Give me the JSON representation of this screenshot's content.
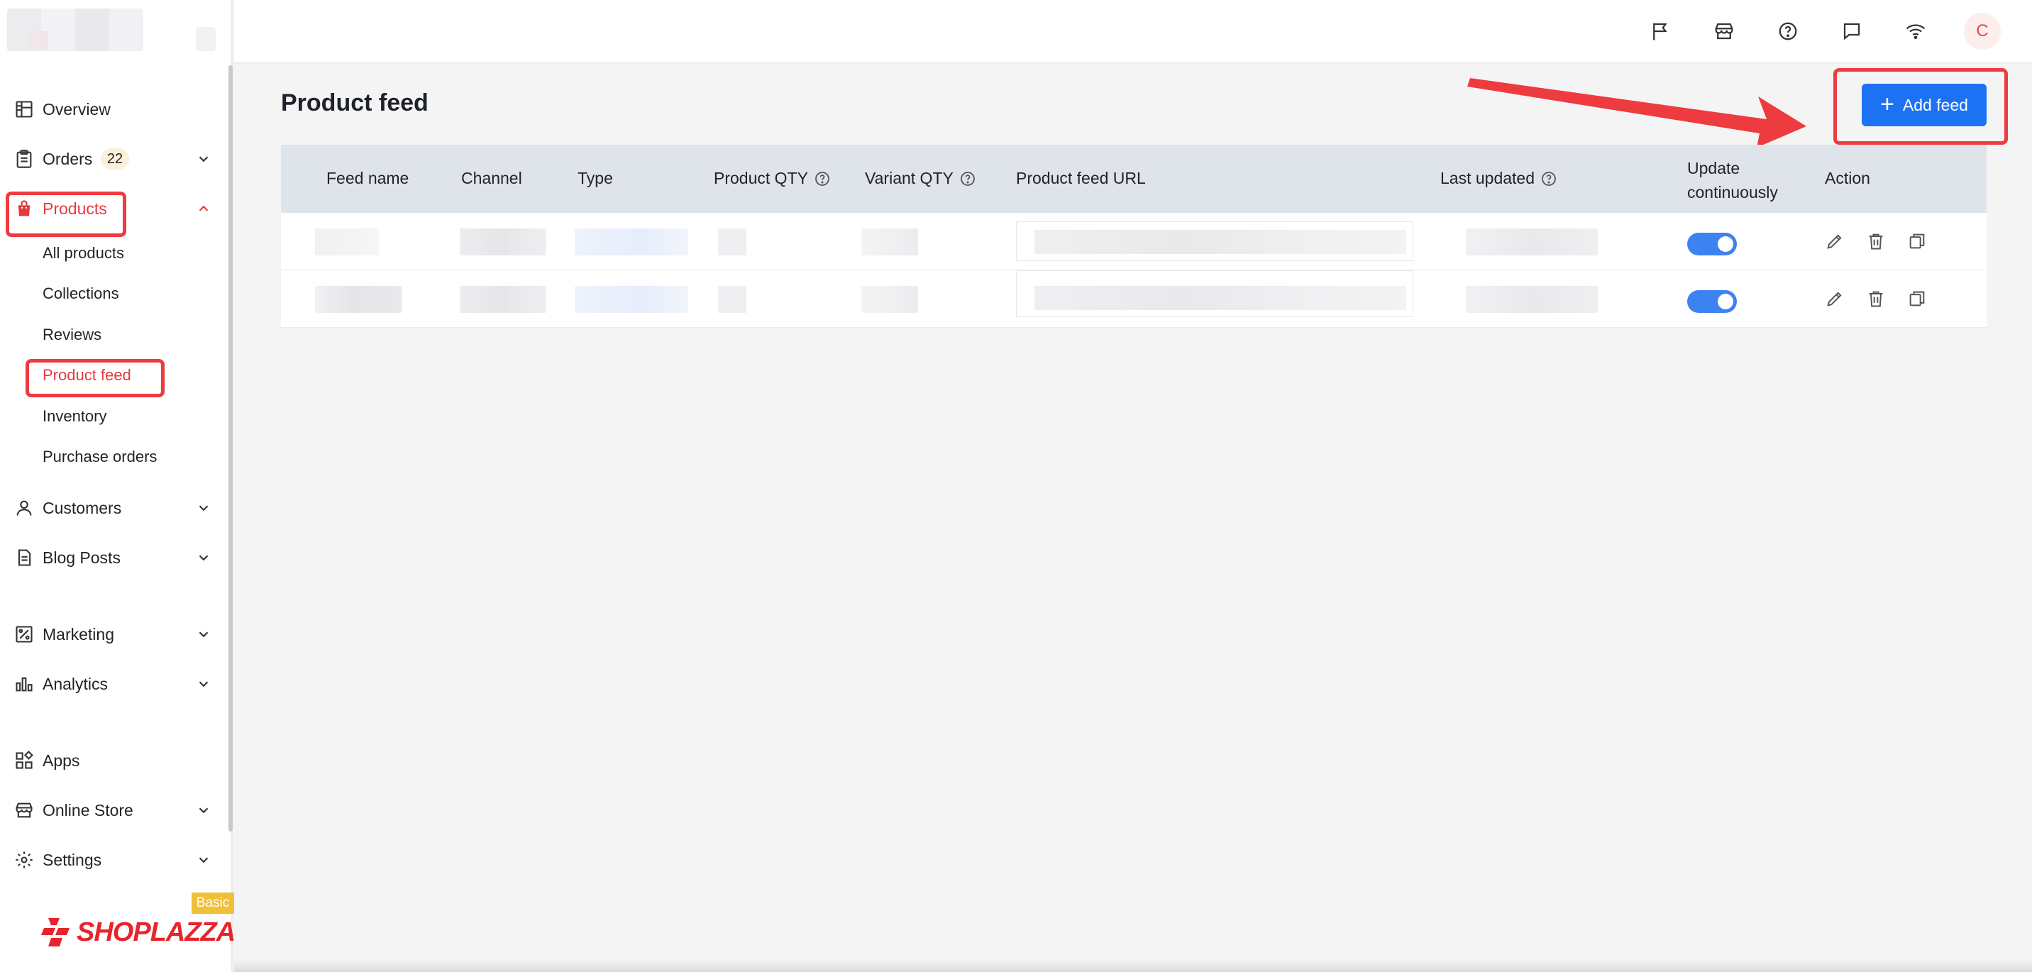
{
  "sidebar": {
    "items": [
      {
        "label": "Overview",
        "icon": "overview-icon"
      },
      {
        "label": "Orders",
        "icon": "orders-icon",
        "badge": "22"
      },
      {
        "label": "Products",
        "icon": "shopping-bag-icon"
      },
      {
        "label": "Customers",
        "icon": "user-icon"
      },
      {
        "label": "Blog Posts",
        "icon": "document-icon"
      },
      {
        "label": "Marketing",
        "icon": "marketing-icon"
      },
      {
        "label": "Analytics",
        "icon": "bar-chart-icon"
      },
      {
        "label": "Apps",
        "icon": "apps-icon"
      },
      {
        "label": "Online Store",
        "icon": "store-icon"
      },
      {
        "label": "Settings",
        "icon": "gear-icon"
      }
    ],
    "products_sub": [
      "All products",
      "Collections",
      "Reviews",
      "Product feed",
      "Inventory",
      "Purchase orders"
    ],
    "plan": "Basic",
    "brand": "SHOPLAZZA"
  },
  "topbar": {
    "icons": [
      "flag-icon",
      "store-icon",
      "help-icon",
      "chat-icon",
      "wifi-icon"
    ],
    "avatar_initial": "C"
  },
  "main": {
    "title": "Product feed",
    "add_button": "Add feed",
    "columns": {
      "feed_name": "Feed name",
      "channel": "Channel",
      "type": "Type",
      "product_qty": "Product QTY",
      "variant_qty": "Variant QTY",
      "feed_url": "Product feed URL",
      "last_updated": "Last updated",
      "update_line1": "Update",
      "update_line2": "continuously",
      "action": "Action"
    },
    "rows": [
      {
        "update_continuously": true
      },
      {
        "update_continuously": true
      }
    ]
  },
  "colors": {
    "accent": "#1d72f3",
    "active": "#e6393d",
    "highlight": "#ee3b3f",
    "toggle": "#3d82f1"
  }
}
